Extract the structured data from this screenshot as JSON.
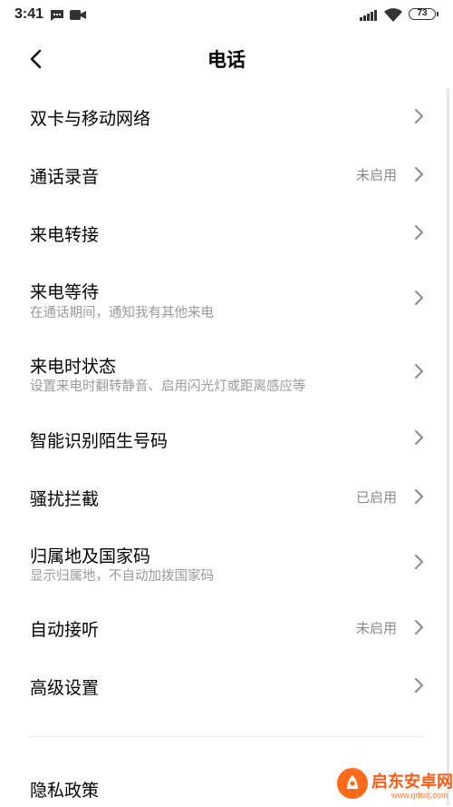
{
  "status_bar": {
    "time": "3:41",
    "battery": "73"
  },
  "header": {
    "title": "电话"
  },
  "settings": [
    {
      "title": "双卡与移动网络",
      "subtitle": "",
      "status": ""
    },
    {
      "title": "通话录音",
      "subtitle": "",
      "status": "未启用"
    },
    {
      "title": "来电转接",
      "subtitle": "",
      "status": ""
    },
    {
      "title": "来电等待",
      "subtitle": "在通话期间，通知我有其他来电",
      "status": ""
    },
    {
      "title": "来电时状态",
      "subtitle": "设置来电时翻转静音、启用闪光灯或距离感应等",
      "status": ""
    },
    {
      "title": "智能识别陌生号码",
      "subtitle": "",
      "status": ""
    },
    {
      "title": "骚扰拦截",
      "subtitle": "",
      "status": "已启用"
    },
    {
      "title": "归属地及国家码",
      "subtitle": "显示归属地，不自动加拨国家码",
      "status": ""
    },
    {
      "title": "自动接听",
      "subtitle": "",
      "status": "未启用"
    },
    {
      "title": "高级设置",
      "subtitle": "",
      "status": ""
    },
    {
      "title": "隐私政策",
      "subtitle": "",
      "status": ""
    }
  ],
  "watermark": {
    "name": "启东安卓网",
    "url": "www.qdtidj.com"
  },
  "colors": {
    "background": "#ffffff",
    "subtitle": "#9a9a9a",
    "chevron": "#8a8a8a"
  }
}
